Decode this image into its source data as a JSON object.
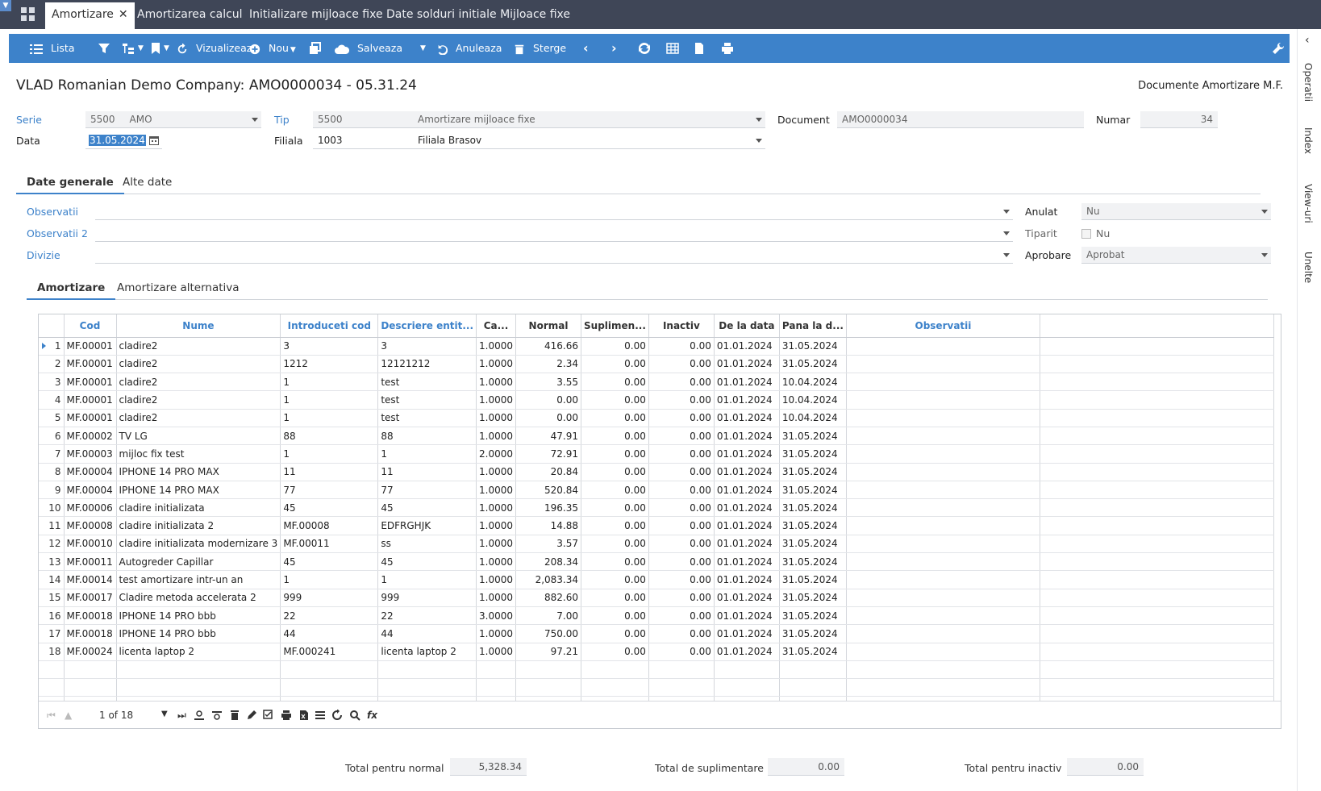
{
  "tabs": [
    {
      "label": "Amortizare"
    },
    {
      "label": "Amortizarea calcul"
    },
    {
      "label": "Initializare mijloace fixe"
    },
    {
      "label": "Date solduri initiale Mijloace fixe"
    }
  ],
  "toolbar": {
    "lista": "Lista",
    "vizualizeaza": "Vizualizeaz",
    "nou": "Nou",
    "salveaza": "Salveaza",
    "anuleaza": "Anuleaza",
    "sterge": "Sterge"
  },
  "right_rail": [
    "Operatii",
    "Index",
    "View-uri",
    "Unelte"
  ],
  "header": {
    "title": "VLAD Romanian Demo Company: AMO0000034 - 05.31.24",
    "right_title": "Documente Amortizare M.F."
  },
  "form": {
    "serie_label": "Serie",
    "serie_code": "5500",
    "serie_name": "AMO",
    "tip_label": "Tip",
    "tip_code": "5500",
    "tip_name": "Amortizare mijloace fixe",
    "document_label": "Document",
    "document_value": "AMO0000034",
    "numar_label": "Numar",
    "numar_value": "34",
    "data_label": "Data",
    "data_value": "31.05.2024",
    "filiala_label": "Filiala",
    "filiala_code": "1003",
    "filiala_name": "Filiala Brasov"
  },
  "section_tabs": [
    {
      "label": "Date generale"
    },
    {
      "label": "Alte date"
    }
  ],
  "general": {
    "observatii_label": "Observatii",
    "observatii2_label": "Observatii 2",
    "divizie_label": "Divizie",
    "anulat_label": "Anulat",
    "anulat_value": "Nu",
    "tiparit_label": "Tiparit",
    "tiparit_value": "Nu",
    "aprobare_label": "Aprobare",
    "aprobare_value": "Aprobat"
  },
  "grid_tabs": [
    {
      "label": "Amortizare"
    },
    {
      "label": "Amortizare alternativa"
    }
  ],
  "grid": {
    "columns": [
      "Cod",
      "Nume",
      "Introduceti cod",
      "Descriere entit...",
      "Ca...",
      "Normal",
      "Suplimen...",
      "Inactiv",
      "De la data",
      "Pana la d...",
      "Observatii"
    ],
    "rows": [
      [
        "1",
        "MF.00001",
        "cladire2",
        "3",
        "3",
        "1.0000",
        "416.66",
        "0.00",
        "0.00",
        "01.01.2024",
        "31.05.2024"
      ],
      [
        "2",
        "MF.00001",
        "cladire2",
        "1212",
        "12121212",
        "1.0000",
        "2.34",
        "0.00",
        "0.00",
        "01.01.2024",
        "31.05.2024"
      ],
      [
        "3",
        "MF.00001",
        "cladire2",
        "1",
        "test",
        "1.0000",
        "3.55",
        "0.00",
        "0.00",
        "01.01.2024",
        "10.04.2024"
      ],
      [
        "4",
        "MF.00001",
        "cladire2",
        "1",
        "test",
        "1.0000",
        "0.00",
        "0.00",
        "0.00",
        "01.01.2024",
        "10.04.2024"
      ],
      [
        "5",
        "MF.00001",
        "cladire2",
        "1",
        "test",
        "1.0000",
        "0.00",
        "0.00",
        "0.00",
        "01.01.2024",
        "10.04.2024"
      ],
      [
        "6",
        "MF.00002",
        "TV LG",
        "88",
        "88",
        "1.0000",
        "47.91",
        "0.00",
        "0.00",
        "01.01.2024",
        "31.05.2024"
      ],
      [
        "7",
        "MF.00003",
        "mijloc fix test",
        "1",
        "1",
        "2.0000",
        "72.91",
        "0.00",
        "0.00",
        "01.01.2024",
        "31.05.2024"
      ],
      [
        "8",
        "MF.00004",
        "IPHONE 14 PRO MAX",
        "11",
        "11",
        "1.0000",
        "20.84",
        "0.00",
        "0.00",
        "01.01.2024",
        "31.05.2024"
      ],
      [
        "9",
        "MF.00004",
        "IPHONE 14 PRO MAX",
        "77",
        "77",
        "1.0000",
        "520.84",
        "0.00",
        "0.00",
        "01.01.2024",
        "31.05.2024"
      ],
      [
        "10",
        "MF.00006",
        "cladire initializata",
        "45",
        "45",
        "1.0000",
        "196.35",
        "0.00",
        "0.00",
        "01.01.2024",
        "31.05.2024"
      ],
      [
        "11",
        "MF.00008",
        "cladire initializata 2",
        "MF.00008",
        "EDFRGHJK",
        "1.0000",
        "14.88",
        "0.00",
        "0.00",
        "01.01.2024",
        "31.05.2024"
      ],
      [
        "12",
        "MF.00010",
        "cladire initializata modernizare 3",
        "MF.00011",
        "ss",
        "1.0000",
        "3.57",
        "0.00",
        "0.00",
        "01.01.2024",
        "31.05.2024"
      ],
      [
        "13",
        "MF.00011",
        "Autogreder Capillar",
        "45",
        "45",
        "1.0000",
        "208.34",
        "0.00",
        "0.00",
        "01.01.2024",
        "31.05.2024"
      ],
      [
        "14",
        "MF.00014",
        "test amortizare intr-un an",
        "1",
        "1",
        "1.0000",
        "2,083.34",
        "0.00",
        "0.00",
        "01.01.2024",
        "31.05.2024"
      ],
      [
        "15",
        "MF.00017",
        "Cladire metoda accelerata 2",
        "999",
        "999",
        "1.0000",
        "882.60",
        "0.00",
        "0.00",
        "01.01.2024",
        "31.05.2024"
      ],
      [
        "16",
        "MF.00018",
        "IPHONE 14 PRO bbb",
        "22",
        "22",
        "3.0000",
        "7.00",
        "0.00",
        "0.00",
        "01.01.2024",
        "31.05.2024"
      ],
      [
        "17",
        "MF.00018",
        "IPHONE 14 PRO bbb",
        "44",
        "44",
        "1.0000",
        "750.00",
        "0.00",
        "0.00",
        "01.01.2024",
        "31.05.2024"
      ],
      [
        "18",
        "MF.00024",
        "licenta laptop 2",
        "MF.000241",
        "licenta laptop 2",
        "1.0000",
        "97.21",
        "0.00",
        "0.00",
        "01.01.2024",
        "31.05.2024"
      ]
    ],
    "pager_text": "1 of 18"
  },
  "totals": {
    "normal_label": "Total pentru normal",
    "normal_value": "5,328.34",
    "suplimentare_label": "Total de suplimentare",
    "suplimentare_value": "0.00",
    "inactiv_label": "Total pentru inactiv",
    "inactiv_value": "0.00"
  },
  "colors": {
    "toolbar": "#3d82ca",
    "topbar": "#3f4657",
    "accent": "#3d82ca"
  }
}
